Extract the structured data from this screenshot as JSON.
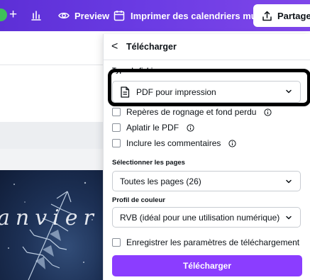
{
  "topbar": {
    "plus_glyph": "+",
    "preview_label": "Preview",
    "print_label": "Imprimer des calendriers muraux",
    "share_label": "Partager"
  },
  "artwork": {
    "text": "anvier"
  },
  "panel": {
    "back_glyph": "<",
    "title": "Télécharger",
    "file_type_label": "Type de fichier",
    "file_type_value": "PDF pour impression",
    "options": [
      {
        "label": "Repères de rognage et fond perdu",
        "checked": false,
        "info": true
      },
      {
        "label": "Aplatir le PDF",
        "checked": false,
        "info": true
      },
      {
        "label": "Inclure les commentaires",
        "checked": false,
        "info": true
      }
    ],
    "pages_label": "Sélectionner les pages",
    "pages_value": "Toutes les pages (26)",
    "color_profile_label": "Profil de couleur",
    "color_profile_value": "RVB (idéal pour une utilisation numérique)",
    "save_settings_label": "Enregistrer les paramètres de téléchargement",
    "download_button": "Télécharger"
  },
  "colors": {
    "topbar_start": "#5d2fd6",
    "topbar_end": "#7f46ea",
    "primary_button": "#8b3dff",
    "highlight_border": "#000000"
  },
  "icons": [
    "plus-icon",
    "chart-icon",
    "eye-icon",
    "calendar-icon",
    "share-upload-icon",
    "back-chevron-icon",
    "document-icon",
    "chevron-down-icon",
    "info-icon"
  ]
}
